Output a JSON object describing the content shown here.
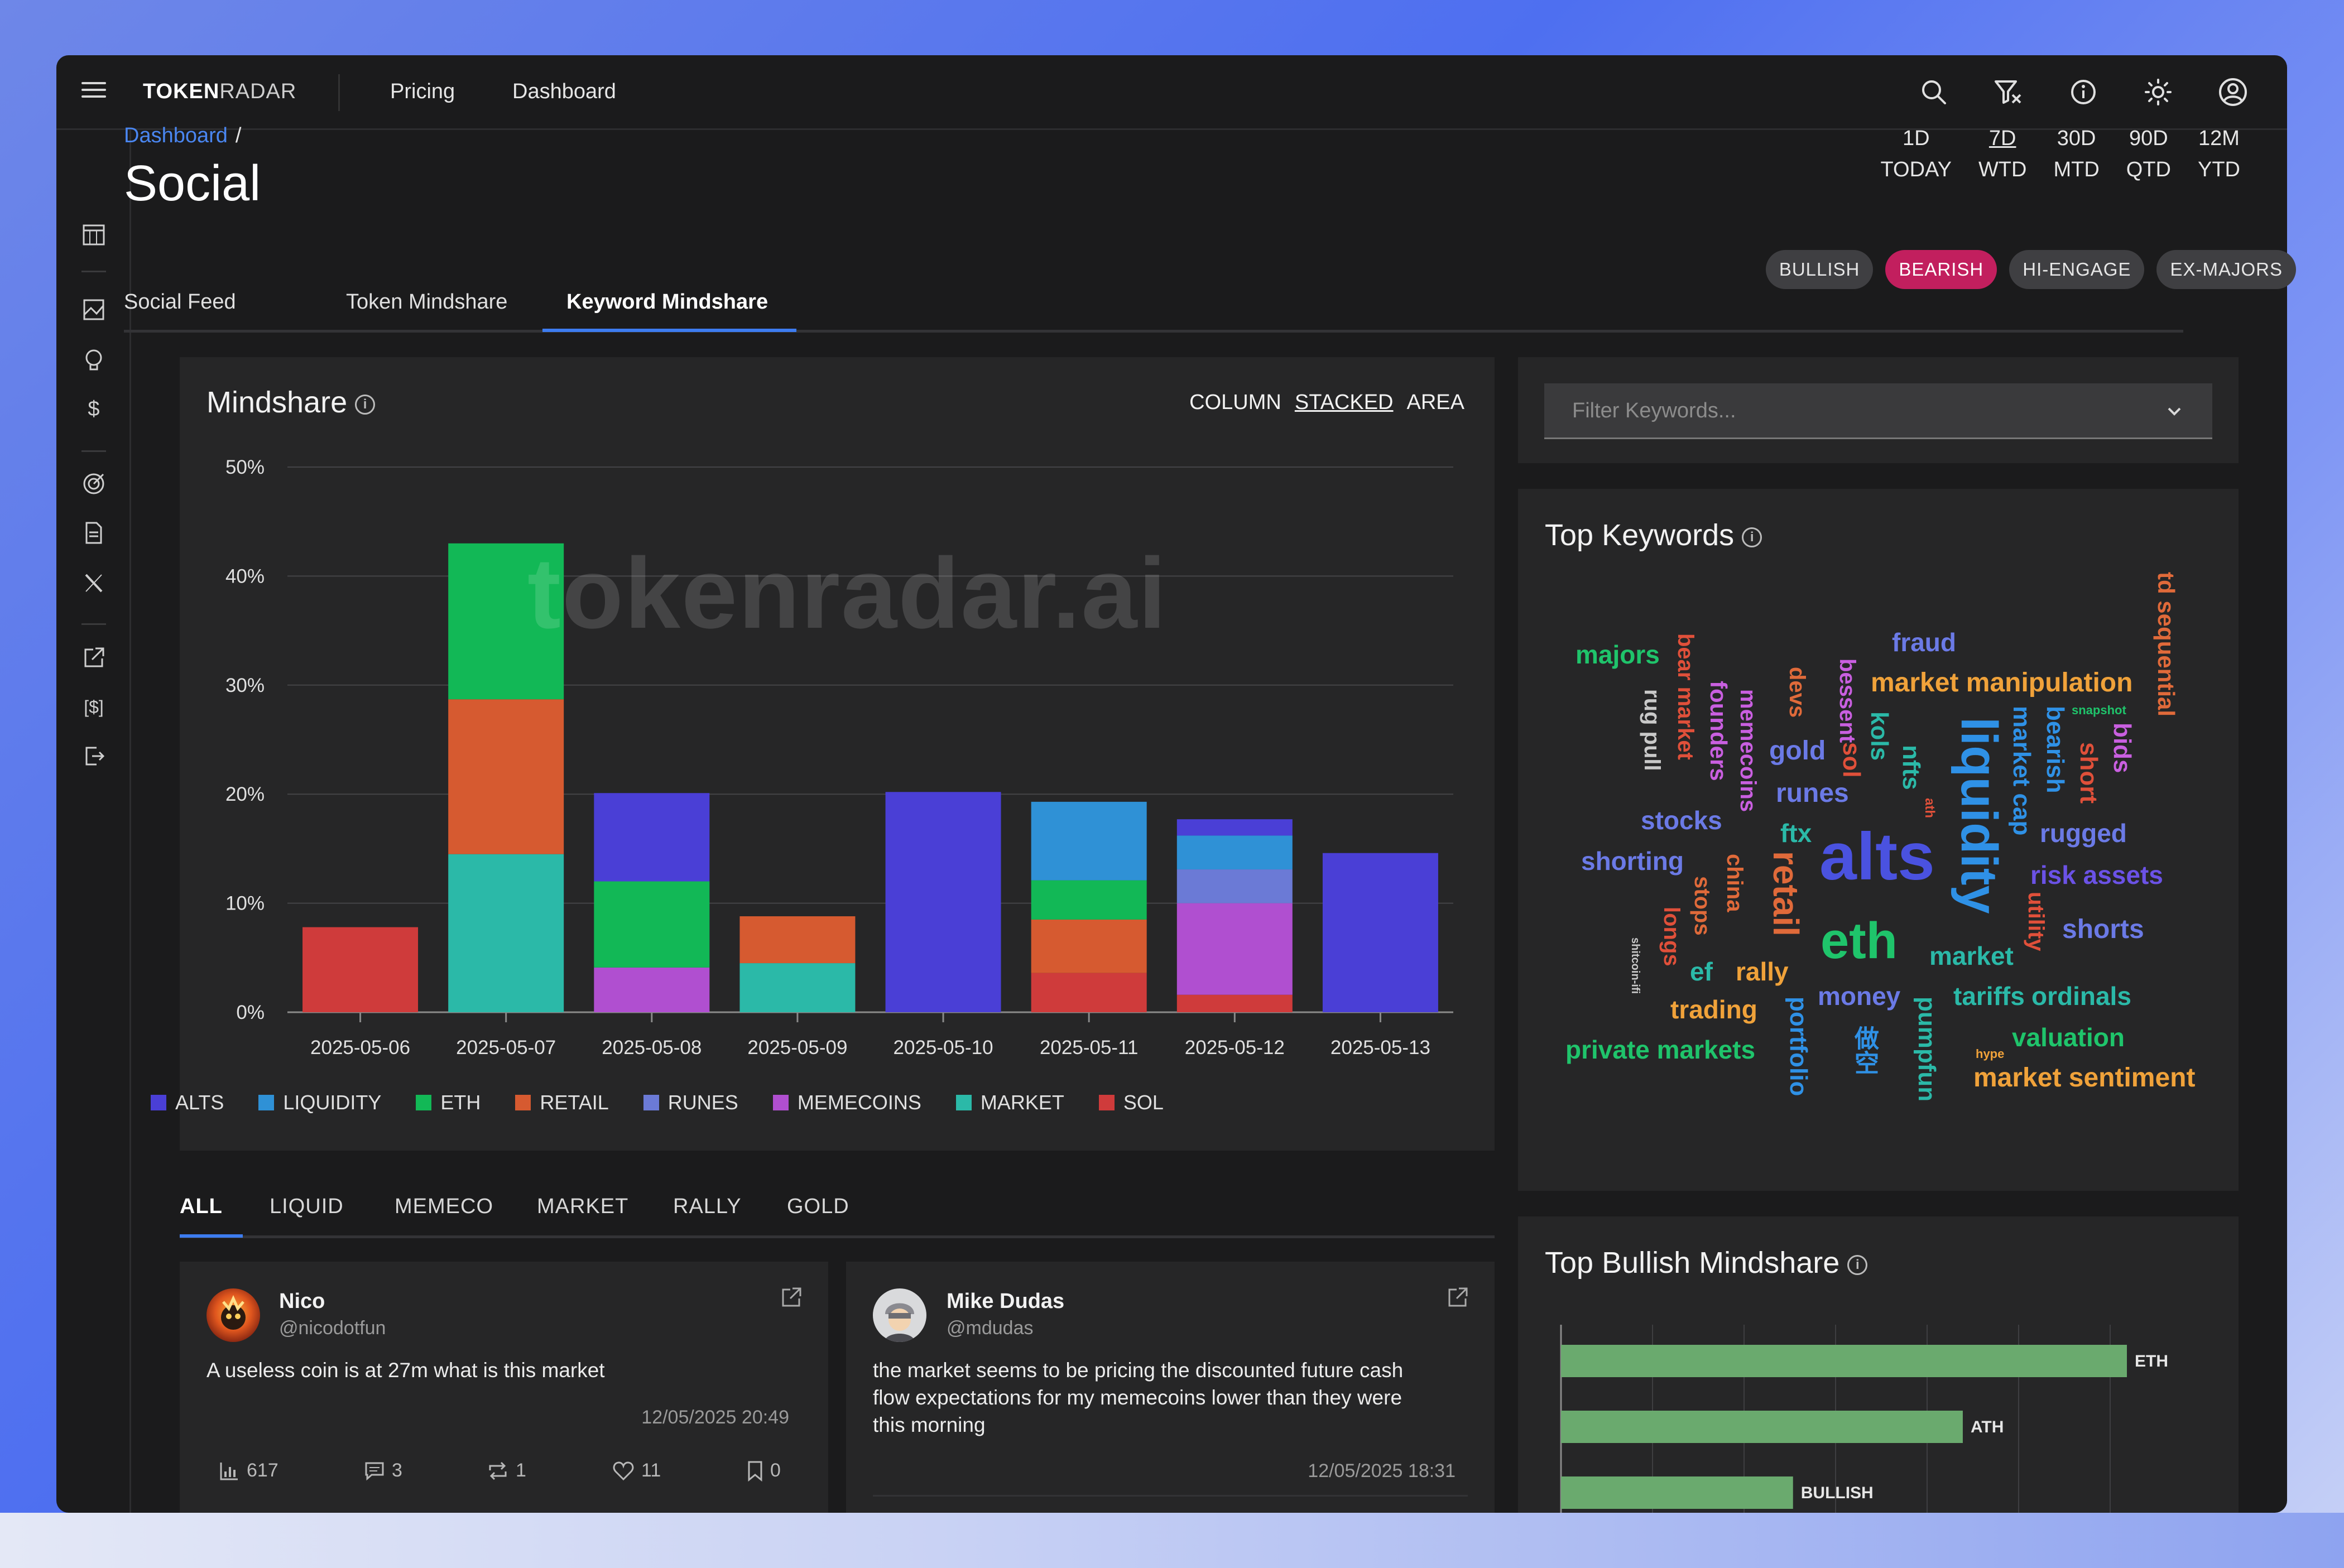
{
  "app": {
    "logo_bold": "TOKEN",
    "logo_light": "RADAR",
    "nav": [
      "Pricing",
      "Dashboard"
    ]
  },
  "colors": {
    "accent": "#3d7cf0",
    "bearish_pill": "#c21f5e",
    "bar_fill": "#6aaa6e"
  },
  "breadcrumb": {
    "link": "Dashboard",
    "separator": "/"
  },
  "page_title": "Social",
  "tabs": [
    "Social Feed",
    "Token Mindshare",
    "Keyword Mindshare"
  ],
  "active_tab": "Keyword Mindshare",
  "periods": [
    {
      "top": "1D",
      "bottom": "TODAY"
    },
    {
      "top": "7D",
      "bottom": "WTD"
    },
    {
      "top": "30D",
      "bottom": "MTD"
    },
    {
      "top": "90D",
      "bottom": "QTD"
    },
    {
      "top": "12M",
      "bottom": "YTD"
    }
  ],
  "filters": [
    "BULLISH",
    "BEARISH",
    "HI-ENGAGE",
    "EX-MAJORS"
  ],
  "mindshare": {
    "title": "Mindshare",
    "chart_types": [
      "COLUMN",
      "STACKED",
      "AREA"
    ],
    "selected_type": "STACKED",
    "watermark": "tokenradar.ai"
  },
  "chart_data": {
    "type": "bar",
    "stacked": true,
    "categories": [
      "2025-05-06",
      "2025-05-07",
      "2025-05-08",
      "2025-05-09",
      "2025-05-10",
      "2025-05-11",
      "2025-05-12",
      "2025-05-13"
    ],
    "y_ticks": [
      "0%",
      "10%",
      "20%",
      "30%",
      "40%",
      "50%"
    ],
    "ylim": [
      0,
      50
    ],
    "grid": true,
    "legend_position": "bottom",
    "series": [
      {
        "name": "SOL",
        "color": "#cf3b3b",
        "values": [
          7.8,
          0,
          0,
          0,
          0,
          3.6,
          1.6,
          0
        ]
      },
      {
        "name": "MARKET",
        "color": "#2bb9a8",
        "values": [
          0,
          14.5,
          0,
          4.5,
          0,
          0,
          0,
          0
        ]
      },
      {
        "name": "MEMECOINS",
        "color": "#b04fd0",
        "values": [
          0,
          0,
          4.1,
          0,
          0,
          0,
          8.4,
          0
        ]
      },
      {
        "name": "RETAIL",
        "color": "#d65a30",
        "values": [
          0,
          14.2,
          0,
          4.3,
          0,
          4.9,
          0,
          0
        ]
      },
      {
        "name": "ETH",
        "color": "#12b856",
        "values": [
          0,
          14.3,
          7.9,
          0,
          0,
          3.6,
          0,
          0
        ]
      },
      {
        "name": "RUNES",
        "color": "#6b7ad6",
        "values": [
          0,
          0,
          0,
          0,
          0,
          0,
          3.1,
          0
        ]
      },
      {
        "name": "LIQUIDITY",
        "color": "#2f91d6",
        "values": [
          0,
          0,
          0,
          0,
          0,
          7.2,
          3.1,
          0
        ]
      },
      {
        "name": "ALTS",
        "color": "#4a3fd6",
        "values": [
          0,
          0,
          8.1,
          0,
          20.2,
          0,
          1.5,
          14.6
        ]
      }
    ],
    "legend_order": [
      "ALTS",
      "LIQUIDITY",
      "ETH",
      "RETAIL",
      "RUNES",
      "MEMECOINS",
      "MARKET",
      "SOL"
    ]
  },
  "post_tabs": [
    "ALL",
    "LIQUID",
    "MEMECO",
    "MARKET",
    "RALLY",
    "GOLD"
  ],
  "posts": [
    {
      "name": "Nico",
      "handle": "@nicodotfun",
      "text": "A useless coin is at 27m what is this market",
      "date": "12/05/2025 20:49",
      "stats": {
        "views": "617",
        "replies": "3",
        "reposts": "1",
        "likes": "11",
        "bookmarks": "0"
      }
    },
    {
      "name": "Mike Dudas",
      "handle": "@mdudas",
      "text_lines": [
        "the market seems to be pricing the discounted future cash",
        "flow expectations for my memecoins lower than they were",
        "this morning"
      ],
      "date": "12/05/2025 18:31"
    }
  ],
  "filter_keywords": {
    "placeholder": "Filter Keywords..."
  },
  "top_keywords": {
    "title": "Top Keywords",
    "words": [
      {
        "text": "majors",
        "color": "#1fc46b",
        "size": 46,
        "vertical": false
      },
      {
        "text": "bear market",
        "color": "#e0503a",
        "size": 40,
        "vertical": true
      },
      {
        "text": "rug pull",
        "color": "#c9c9c9",
        "size": 40,
        "vertical": true
      },
      {
        "text": "founders",
        "color": "#c95fe0",
        "size": 42,
        "vertical": true
      },
      {
        "text": "memecoins",
        "color": "#c95fe0",
        "size": 40,
        "vertical": true
      },
      {
        "text": "devs",
        "color": "#e06a3a",
        "size": 40,
        "vertical": true
      },
      {
        "text": "bessent",
        "color": "#c95fe0",
        "size": 40,
        "vertical": true
      },
      {
        "text": "fraud",
        "color": "#6b7ae6",
        "size": 46,
        "vertical": false
      },
      {
        "text": "market manipulation",
        "color": "#f0a23a",
        "size": 48,
        "vertical": false
      },
      {
        "text": "td sequential",
        "color": "#e06a3a",
        "size": 42,
        "vertical": true
      },
      {
        "text": "gold",
        "color": "#6b7ae6",
        "size": 48,
        "vertical": false
      },
      {
        "text": "kols",
        "color": "#2bb9a8",
        "size": 44,
        "vertical": true
      },
      {
        "text": "nfts",
        "color": "#2bb9a8",
        "size": 44,
        "vertical": true
      },
      {
        "text": "sol",
        "color": "#e0503a",
        "size": 44,
        "vertical": true
      },
      {
        "text": "liquidity",
        "color": "#2f91e6",
        "size": 92,
        "vertical": true
      },
      {
        "text": "market cap",
        "color": "#2f91e6",
        "size": 44,
        "vertical": true
      },
      {
        "text": "bearish",
        "color": "#2f91e6",
        "size": 44,
        "vertical": true
      },
      {
        "text": "short",
        "color": "#e0503a",
        "size": 44,
        "vertical": true
      },
      {
        "text": "bids",
        "color": "#c95fe0",
        "size": 44,
        "vertical": true
      },
      {
        "text": "snapshot",
        "color": "#1fc46b",
        "size": 22,
        "vertical": false
      },
      {
        "text": "ath",
        "color": "#e0503a",
        "size": 24,
        "vertical": true
      },
      {
        "text": "runes",
        "color": "#6b7ae6",
        "size": 48,
        "vertical": false
      },
      {
        "text": "stocks",
        "color": "#6b7ae6",
        "size": 46,
        "vertical": false
      },
      {
        "text": "ftx",
        "color": "#2bb9a8",
        "size": 46,
        "vertical": false
      },
      {
        "text": "alts",
        "color": "#4a52e0",
        "size": 120,
        "vertical": false
      },
      {
        "text": "rugged",
        "color": "#6b7ae6",
        "size": 46,
        "vertical": false
      },
      {
        "text": "shorting",
        "color": "#6b7ae6",
        "size": 46,
        "vertical": false
      },
      {
        "text": "china",
        "color": "#e06a3a",
        "size": 40,
        "vertical": true
      },
      {
        "text": "retail",
        "color": "#e06a3a",
        "size": 64,
        "vertical": true
      },
      {
        "text": "risk assets",
        "color": "#6b52e6",
        "size": 46,
        "vertical": false
      },
      {
        "text": "stops",
        "color": "#e06a3a",
        "size": 40,
        "vertical": true
      },
      {
        "text": "longs",
        "color": "#e0503a",
        "size": 40,
        "vertical": true
      },
      {
        "text": "utility",
        "color": "#e0503a",
        "size": 40,
        "vertical": true
      },
      {
        "text": "eth",
        "color": "#1fc46b",
        "size": 92,
        "vertical": false
      },
      {
        "text": "shorts",
        "color": "#6b7ae6",
        "size": 48,
        "vertical": false
      },
      {
        "text": "shitcoin-ifi",
        "color": "#c9c9c9",
        "size": 20,
        "vertical": true
      },
      {
        "text": "ef",
        "color": "#2bb9a8",
        "size": 46,
        "vertical": false
      },
      {
        "text": "rally",
        "color": "#f0a23a",
        "size": 46,
        "vertical": false
      },
      {
        "text": "market",
        "color": "#2bb9a8",
        "size": 46,
        "vertical": false
      },
      {
        "text": "money",
        "color": "#6b7ae6",
        "size": 46,
        "vertical": false
      },
      {
        "text": "tariffs",
        "color": "#2bb9a8",
        "size": 46,
        "vertical": false
      },
      {
        "text": "ordinals",
        "color": "#2bb9a8",
        "size": 46,
        "vertical": false
      },
      {
        "text": "trading",
        "color": "#f0a23a",
        "size": 46,
        "vertical": false
      },
      {
        "text": "portfolio",
        "color": "#2f91e6",
        "size": 44,
        "vertical": true
      },
      {
        "text": "pumpfun",
        "color": "#2bb9a8",
        "size": 44,
        "vertical": true
      },
      {
        "text": "valuation",
        "color": "#1fc46b",
        "size": 46,
        "vertical": false
      },
      {
        "text": "private markets",
        "color": "#1fc46b",
        "size": 46,
        "vertical": false
      },
      {
        "text": "做空",
        "color": "#2f91e6",
        "size": 44,
        "vertical": true
      },
      {
        "text": "hype",
        "color": "#f0a23a",
        "size": 22,
        "vertical": false
      },
      {
        "text": "market sentiment",
        "color": "#f0a23a",
        "size": 48,
        "vertical": false
      }
    ]
  },
  "bullish": {
    "title": "Top Bullish Mindshare",
    "bars": [
      {
        "label": "ETH",
        "value": 100
      },
      {
        "label": "ATH",
        "value": 71
      },
      {
        "label": "BULLISH",
        "value": 41
      }
    ]
  }
}
